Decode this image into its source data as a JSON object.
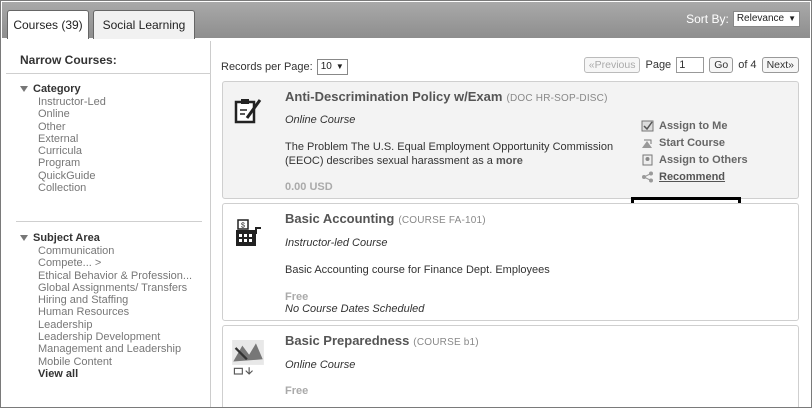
{
  "tabs": [
    {
      "label": "Courses (39)",
      "active": true
    },
    {
      "label": "Social Learning",
      "active": false
    }
  ],
  "sort": {
    "label": "Sort By:",
    "value": "Relevance"
  },
  "sidebar": {
    "title": "Narrow Courses:",
    "category": {
      "heading": "Category",
      "items": [
        "Instructor-Led",
        "Online",
        "Other",
        "External",
        "Curricula",
        "Program",
        "QuickGuide",
        "Collection"
      ]
    },
    "subject_area": {
      "heading": "Subject Area",
      "items": [
        "Communication",
        "Compete... >",
        "Ethical Behavior & Profession...",
        "Global Assignments/ Transfers",
        "Hiring and Staffing",
        "Human Resources",
        "Leadership",
        "Leadership Development",
        "Management and Leadership",
        "Mobile Content"
      ],
      "view_all": "View all"
    }
  },
  "toolbar": {
    "records_label": "Records per Page:",
    "records_value": "10",
    "prev": "«Previous",
    "page_label": "Page",
    "page_value": "1",
    "go": "Go",
    "of_label": "of 4",
    "next": "Next»"
  },
  "courses": [
    {
      "title": "Anti-Descrimination Policy w/Exam",
      "code": "(DOC HR-SOP-DISC)",
      "type": "Online Course",
      "desc": "The Problem The U.S. Equal Employment Opportunity Commission (EEOC) describes sexual harassment as a",
      "more": "more",
      "price": "0.00 USD",
      "icon": "document-edit-icon",
      "actions": [
        "Assign to Me",
        "Start Course",
        "Assign to Others",
        "Recommend"
      ]
    },
    {
      "title": "Basic Accounting",
      "code": "(COURSE FA-101)",
      "type": "Instructor-led Course",
      "desc": "Basic Accounting course for Finance Dept. Employees",
      "price": "Free",
      "note": "No Course Dates Scheduled",
      "icon": "calculator-icon"
    },
    {
      "title": "Basic Preparedness",
      "code": "(COURSE b1)",
      "type": "Online Course",
      "price": "Free",
      "icon": "course-thumbnail-icon"
    }
  ]
}
